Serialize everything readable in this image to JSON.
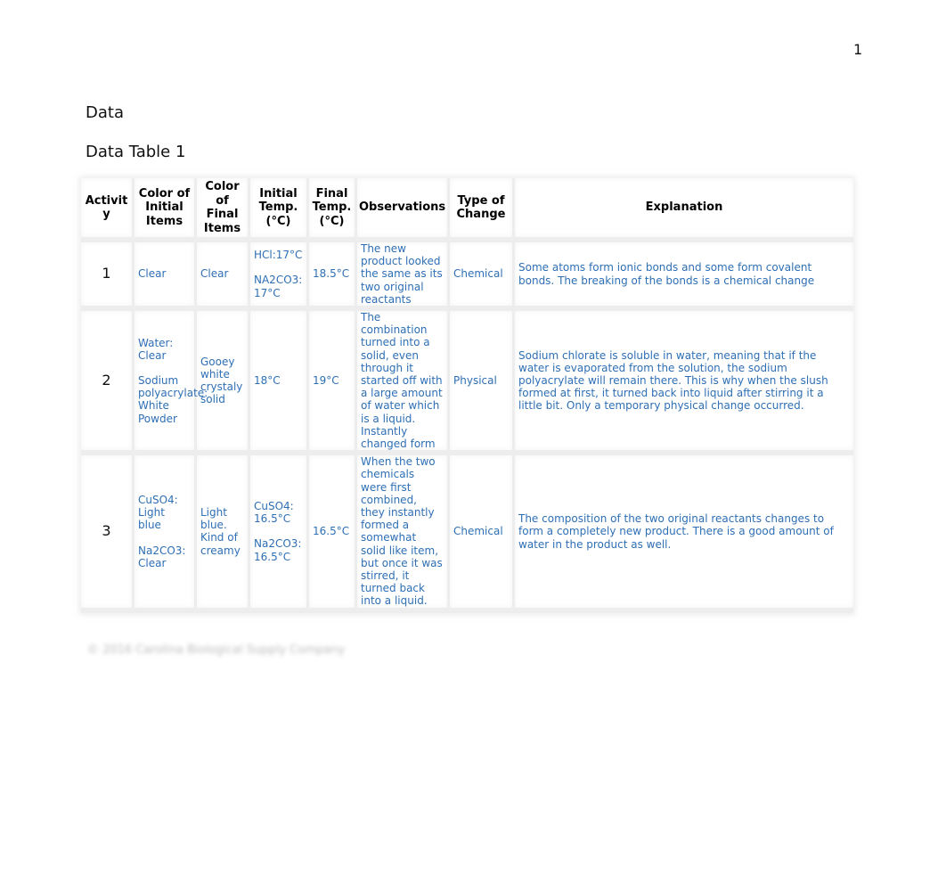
{
  "page_number": "1",
  "heading": "Data",
  "table_title": "Data Table 1",
  "table": {
    "headers": [
      "Activity",
      "Color of Initial Items",
      "Color of Final Items",
      "Initial Temp. (°C)",
      "Final Temp. (°C)",
      "Observations",
      "Type of Change",
      "Explanation"
    ],
    "header_display": {
      "activity": "Activit y",
      "color_initial": "Color of Initial Items",
      "color_final": "Color of Final Items",
      "initial_temp": "Initial Temp. (°C)",
      "final_temp": "Final Temp. (°C)",
      "observations": "Observations",
      "type_of_change": "Type of Change",
      "explanation": "Explanation"
    },
    "rows": [
      {
        "activity": "1",
        "color_initial": [
          "Clear"
        ],
        "color_final": "Clear",
        "initial_temp": [
          "HCl:17°C",
          "NA2CO3: 17°C"
        ],
        "final_temp": "18.5°C",
        "observations": "The new product looked the same as its two original reactants",
        "type_of_change": "Chemical",
        "explanation": "Some atoms form ionic bonds and some form covalent bonds. The breaking of the bonds is a chemical change"
      },
      {
        "activity": "2",
        "color_initial": [
          "Water: Clear",
          "Sodium polyacrylate: White Powder"
        ],
        "color_final": "Gooey white crystaly solid",
        "initial_temp": [
          "18°C"
        ],
        "final_temp": "19°C",
        "observations": "The combination turned into a solid, even through it started off with a large amount of water which is a liquid. Instantly changed form",
        "type_of_change": "Physical",
        "explanation": "Sodium chlorate is soluble in water, meaning that if the water is evaporated from the solution, the sodium polyacrylate will remain there. This is why when the slush formed at first, it turned back into liquid after stirring it a little bit. Only a temporary physical change occurred."
      },
      {
        "activity": "3",
        "color_initial": [
          "CuSO4: Light blue",
          "Na2CO3: Clear"
        ],
        "color_final": "Light blue. Kind of creamy",
        "initial_temp": [
          "CuSO4: 16.5°C",
          "Na2CO3: 16.5°C"
        ],
        "final_temp": "16.5°C",
        "observations": "When the two chemicals were first combined, they instantly formed a somewhat solid like item, but once it was stirred, it turned back into a liquid.",
        "type_of_change": "Chemical",
        "explanation": "The composition of the two original reactants changes to form a completely new product. There is a good amount of water in the product as well."
      }
    ]
  },
  "footer_note": "© 2016 Carolina Biological Supply Company",
  "colors": {
    "cell_text": "#2e6fb5",
    "header_text": "#000000"
  }
}
